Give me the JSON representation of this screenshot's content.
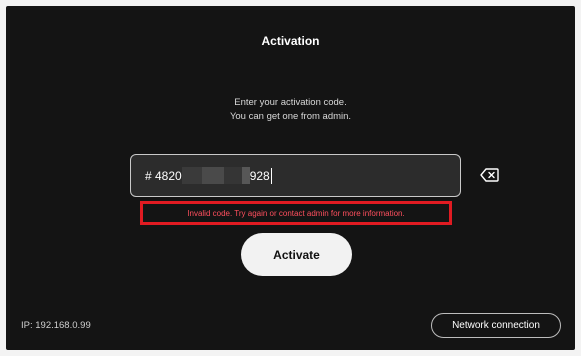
{
  "dialog": {
    "title": "Activation",
    "instructions_line1": "Enter your activation code.",
    "instructions_line2": "You can get one from admin."
  },
  "code_input": {
    "prefix": "# 4820",
    "suffix": "928"
  },
  "error": {
    "message": "Invalid code. Try again or contact admin for more information."
  },
  "actions": {
    "activate_label": "Activate",
    "network_label": "Network connection"
  },
  "status": {
    "ip_text": "IP: 192.168.0.99"
  },
  "icons": {
    "backspace": "backspace-icon"
  },
  "colors": {
    "background": "#141414",
    "error_text": "#ff4f5e",
    "error_highlight": "#e01b22",
    "button": "#f2f2f2"
  }
}
